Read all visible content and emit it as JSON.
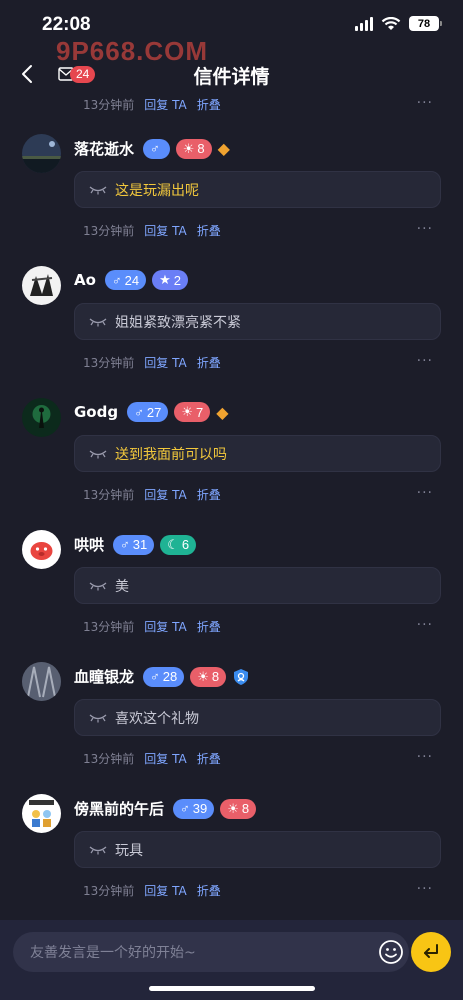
{
  "status_bar": {
    "time": "22:08",
    "battery": "78"
  },
  "nav": {
    "title": "信件详情",
    "mail_badge": "24",
    "watermark": "9P668.COM"
  },
  "meta_labels": {
    "reply": "回复 TA",
    "fold": "折叠",
    "more": "···"
  },
  "first_meta": {
    "time": "13分钟前"
  },
  "comments": [
    {
      "name": "落花逝水",
      "gender_level": "",
      "sun_level": "8",
      "gem": true,
      "text": "这是玩漏出呢",
      "text_color": "#f2c83c",
      "time": "13分钟前"
    },
    {
      "name": "Ao",
      "gender_level": "24",
      "star_level": "2",
      "text": "姐姐紧致漂亮紧不紧",
      "text_color": "#c9cad6",
      "time": "13分钟前"
    },
    {
      "name": "Godg",
      "gender_level": "27",
      "sun_level": "7",
      "gem": true,
      "text": "送到我面前可以吗",
      "text_color": "#f2c83c",
      "time": "13分钟前"
    },
    {
      "name": "哄哄",
      "gender_level": "31",
      "moon_level": "6",
      "text": "美",
      "text_color": "#c9cad6",
      "time": "13分钟前"
    },
    {
      "name": "血瞳银龙",
      "gender_level": "28",
      "sun_level": "8",
      "shield": true,
      "text": "喜欢这个礼物",
      "text_color": "#c9cad6",
      "time": "13分钟前"
    },
    {
      "name": "傍黑前的午后",
      "gender_level": "39",
      "sun_level": "8",
      "text": "玩具",
      "text_color": "#c9cad6",
      "time": "13分钟前"
    }
  ],
  "input": {
    "placeholder": "友善发言是一个好的开始~"
  },
  "colors": {
    "accent": "#f8c514",
    "link": "#7fa6ff",
    "background": "#1c1d29"
  }
}
